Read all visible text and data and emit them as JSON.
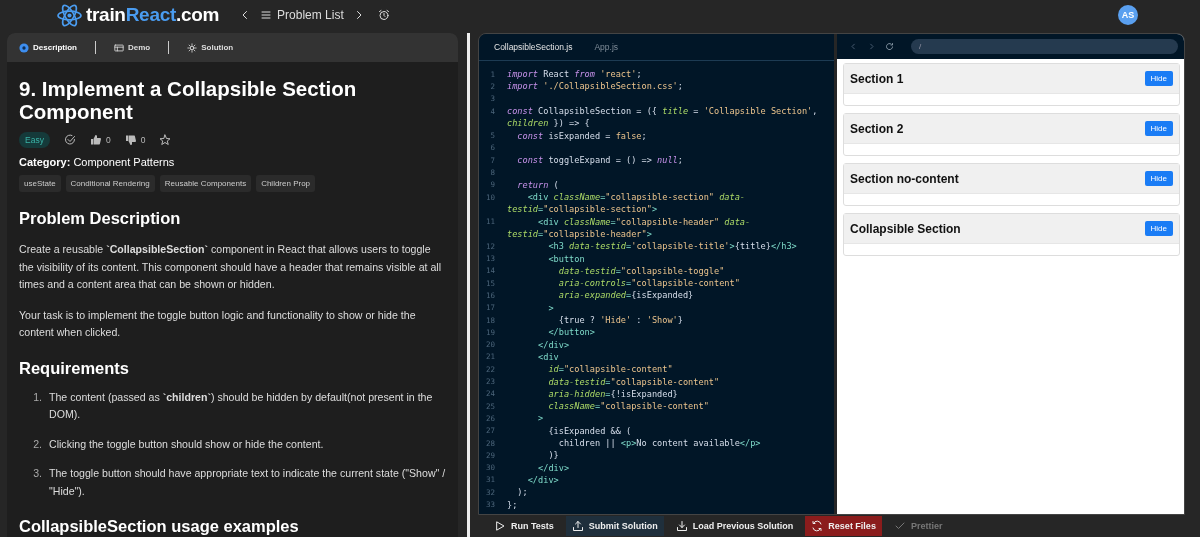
{
  "topbar": {
    "logo": [
      {
        "text": "train",
        "accent": false
      },
      {
        "text": "React",
        "accent": true
      },
      {
        "text": ".com",
        "accent": false
      }
    ],
    "nav_label": "Problem List",
    "avatar": "AS"
  },
  "problem": {
    "tabs": [
      {
        "label": "Description",
        "kind": "description",
        "selected": true
      },
      {
        "label": "Demo",
        "kind": "demo",
        "selected": false
      },
      {
        "label": "Solution",
        "kind": "solution",
        "selected": false
      }
    ],
    "title": "9. Implement a Collapsible Section Component",
    "difficulty": "Easy",
    "solved": false,
    "likes": "0",
    "dislikes": "0",
    "favorite": false,
    "category_label": "Category:",
    "category": "Component Patterns",
    "tags": [
      "useState",
      "Conditional Rendering",
      "Reusable Components",
      "Children Prop"
    ],
    "sections": [
      {
        "kind": "heading",
        "text": "Problem Description"
      },
      {
        "kind": "paragraph",
        "text": "Create a reusable **`CollapsibleSection`** component in React that allows users to toggle the visibility of its content. This component should have a header that remains visible at all times and a content area that can be shown or hidden."
      },
      {
        "kind": "paragraph",
        "text": "Your task is to implement the toggle button logic and functionality to show or hide the content when clicked."
      },
      {
        "kind": "heading",
        "text": "Requirements"
      },
      {
        "kind": "list",
        "items": [
          {
            "number": "1.",
            "text": "The content (passed as **`children`**) should be hidden by default(not present in the DOM)."
          },
          {
            "number": "2.",
            "text": "Clicking the toggle button should show or hide the content."
          },
          {
            "number": "3.",
            "text": "The toggle button should have appropriate text to indicate the current state (\"Show\" / \"Hide\")."
          }
        ]
      },
      {
        "kind": "heading",
        "text": "CollapsibleSection usage examples"
      }
    ]
  },
  "editor": {
    "files": [
      {
        "name": "CollapsibleSection.js",
        "selected": true
      },
      {
        "name": "App.js",
        "selected": false
      }
    ],
    "lines": [
      {
        "number": "1",
        "tokens": [
          {
            "kind": "kw",
            "text": "import"
          },
          {
            "kind": "plain",
            "text": " React "
          },
          {
            "kind": "kw",
            "text": "from"
          },
          {
            "kind": "str",
            "text": " 'react'"
          },
          {
            "kind": "plain",
            "text": ";"
          }
        ]
      },
      {
        "number": "2",
        "tokens": [
          {
            "kind": "kw",
            "text": "import"
          },
          {
            "kind": "str",
            "text": " './CollapsibleSection.css'"
          },
          {
            "kind": "plain",
            "text": ";"
          }
        ]
      },
      {
        "number": "3"
      },
      {
        "number": "4",
        "tokens": [
          {
            "kind": "kw",
            "text": "const"
          },
          {
            "kind": "plain",
            "text": " CollapsibleSection = ({ "
          },
          {
            "kind": "attr",
            "text": "title"
          },
          {
            "kind": "plain",
            "text": " = "
          },
          {
            "kind": "str",
            "text": "'Collapsible Section'"
          },
          {
            "kind": "plain",
            "text": ","
          }
        ]
      },
      {
        "tokens": [
          {
            "kind": "attr",
            "text": "children"
          },
          {
            "kind": "plain",
            "text": " }) => {"
          }
        ]
      },
      {
        "number": "5",
        "tokens": [
          {
            "kind": "kw",
            "text": "  const"
          },
          {
            "kind": "plain",
            "text": " isExpanded = "
          },
          {
            "kind": "str",
            "text": "false"
          },
          {
            "kind": "plain",
            "text": ";"
          }
        ]
      },
      {
        "number": "6"
      },
      {
        "number": "7",
        "tokens": [
          {
            "kind": "kw",
            "text": "  const"
          },
          {
            "kind": "plain",
            "text": " toggleExpand = () => "
          },
          {
            "kind": "kw",
            "text": "null"
          },
          {
            "kind": "plain",
            "text": ";"
          }
        ]
      },
      {
        "number": "8"
      },
      {
        "number": "9",
        "tokens": [
          {
            "kind": "kw",
            "text": "  return"
          },
          {
            "kind": "plain",
            "text": " ("
          }
        ]
      },
      {
        "number": "10",
        "tokens": [
          {
            "kind": "tag",
            "text": "    <div"
          },
          {
            "kind": "attr",
            "text": " className"
          },
          {
            "kind": "tag",
            "text": "="
          },
          {
            "kind": "str",
            "text": "\"collapsible-section\""
          },
          {
            "kind": "attr",
            "text": " data-"
          }
        ]
      },
      {
        "tokens": [
          {
            "kind": "attr",
            "text": "testid"
          },
          {
            "kind": "tag",
            "text": "="
          },
          {
            "kind": "str",
            "text": "\"collapsible-section\""
          },
          {
            "kind": "tag",
            "text": ">"
          }
        ]
      },
      {
        "number": "11",
        "tokens": [
          {
            "kind": "tag",
            "text": "      <div"
          },
          {
            "kind": "attr",
            "text": " className"
          },
          {
            "kind": "tag",
            "text": "="
          },
          {
            "kind": "str",
            "text": "\"collapsible-header\""
          },
          {
            "kind": "attr",
            "text": " data-"
          }
        ]
      },
      {
        "tokens": [
          {
            "kind": "attr",
            "text": "testid"
          },
          {
            "kind": "tag",
            "text": "="
          },
          {
            "kind": "str",
            "text": "\"collapsible-header\""
          },
          {
            "kind": "tag",
            "text": ">"
          }
        ]
      },
      {
        "number": "12",
        "tokens": [
          {
            "kind": "tag",
            "text": "        <h3"
          },
          {
            "kind": "attr",
            "text": " data-testid"
          },
          {
            "kind": "tag",
            "text": "="
          },
          {
            "kind": "str",
            "text": "'collapsible-title'"
          },
          {
            "kind": "tag",
            "text": ">"
          },
          {
            "kind": "plain",
            "text": "{title}"
          },
          {
            "kind": "tag",
            "text": "</h3>"
          }
        ]
      },
      {
        "number": "13",
        "tokens": [
          {
            "kind": "tag",
            "text": "        <button"
          }
        ]
      },
      {
        "number": "14",
        "tokens": [
          {
            "kind": "attr",
            "text": "          data-testid"
          },
          {
            "kind": "tag",
            "text": "="
          },
          {
            "kind": "str",
            "text": "\"collapsible-toggle\""
          }
        ]
      },
      {
        "number": "15",
        "tokens": [
          {
            "kind": "attr",
            "text": "          aria-controls"
          },
          {
            "kind": "tag",
            "text": "="
          },
          {
            "kind": "str",
            "text": "\"collapsible-content\""
          }
        ]
      },
      {
        "number": "16",
        "tokens": [
          {
            "kind": "attr",
            "text": "          aria-expanded"
          },
          {
            "kind": "tag",
            "text": "="
          },
          {
            "kind": "plain",
            "text": "{isExpanded}"
          }
        ]
      },
      {
        "number": "17",
        "tokens": [
          {
            "kind": "tag",
            "text": "        >"
          }
        ]
      },
      {
        "number": "18",
        "tokens": [
          {
            "kind": "plain",
            "text": "          {true ? "
          },
          {
            "kind": "str",
            "text": "'Hide'"
          },
          {
            "kind": "plain",
            "text": " : "
          },
          {
            "kind": "str",
            "text": "'Show'"
          },
          {
            "kind": "plain",
            "text": "}"
          }
        ]
      },
      {
        "number": "19",
        "tokens": [
          {
            "kind": "tag",
            "text": "        </button>"
          }
        ]
      },
      {
        "number": "20",
        "tokens": [
          {
            "kind": "tag",
            "text": "      </div>"
          }
        ]
      },
      {
        "number": "21",
        "tokens": [
          {
            "kind": "tag",
            "text": "      <div"
          }
        ]
      },
      {
        "number": "22",
        "tokens": [
          {
            "kind": "attr",
            "text": "        id"
          },
          {
            "kind": "tag",
            "text": "="
          },
          {
            "kind": "str",
            "text": "\"collapsible-content\""
          }
        ]
      },
      {
        "number": "23",
        "tokens": [
          {
            "kind": "attr",
            "text": "        data-testid"
          },
          {
            "kind": "tag",
            "text": "="
          },
          {
            "kind": "str",
            "text": "\"collapsible-content\""
          }
        ]
      },
      {
        "number": "24",
        "tokens": [
          {
            "kind": "attr",
            "text": "        aria-hidden"
          },
          {
            "kind": "tag",
            "text": "="
          },
          {
            "kind": "plain",
            "text": "{!isExpanded}"
          }
        ]
      },
      {
        "number": "25",
        "tokens": [
          {
            "kind": "attr",
            "text": "        className"
          },
          {
            "kind": "tag",
            "text": "="
          },
          {
            "kind": "str",
            "text": "\"collapsible-content\""
          }
        ]
      },
      {
        "number": "26",
        "tokens": [
          {
            "kind": "tag",
            "text": "      >"
          }
        ]
      },
      {
        "number": "27",
        "tokens": [
          {
            "kind": "plain",
            "text": "        {isExpanded && ("
          }
        ]
      },
      {
        "number": "28",
        "tokens": [
          {
            "kind": "plain",
            "text": "          children || "
          },
          {
            "kind": "tag",
            "text": "<p>"
          },
          {
            "kind": "plain",
            "text": "No content available"
          },
          {
            "kind": "tag",
            "text": "</p>"
          }
        ]
      },
      {
        "number": "29",
        "tokens": [
          {
            "kind": "plain",
            "text": "        )}"
          }
        ]
      },
      {
        "number": "30",
        "tokens": [
          {
            "kind": "tag",
            "text": "      </div>"
          }
        ]
      },
      {
        "number": "31",
        "tokens": [
          {
            "kind": "tag",
            "text": "    </div>"
          }
        ]
      },
      {
        "number": "32",
        "tokens": [
          {
            "kind": "plain",
            "text": "  );"
          }
        ]
      },
      {
        "number": "33",
        "tokens": [
          {
            "kind": "plain",
            "text": "};"
          }
        ]
      }
    ]
  },
  "preview": {
    "url": "/",
    "sections": [
      {
        "title": "Section 1",
        "button": "Hide",
        "expanded": true
      },
      {
        "title": "Section 2",
        "button": "Hide",
        "expanded": true
      },
      {
        "title": "Section no-content",
        "button": "Hide",
        "expanded": true
      },
      {
        "title": "Collapsible Section",
        "button": "Hide",
        "expanded": true
      }
    ]
  },
  "actions": [
    {
      "label": "Run Tests",
      "kind": "run",
      "disabled": false
    },
    {
      "label": "Submit Solution",
      "kind": "submit",
      "disabled": false
    },
    {
      "label": "Load Previous Solution",
      "kind": "load",
      "disabled": false
    },
    {
      "label": "Reset Files",
      "kind": "reset",
      "disabled": false
    },
    {
      "label": "Prettier",
      "kind": "format",
      "disabled": true
    }
  ]
}
